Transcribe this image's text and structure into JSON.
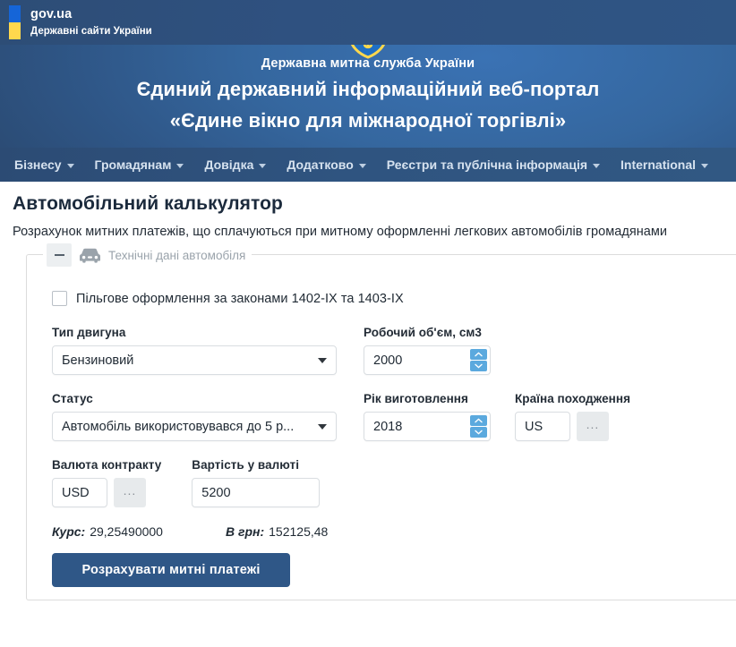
{
  "govbar": {
    "title": "gov.ua",
    "subtitle": "Державні сайти України",
    "flag_blue": "#1565d8",
    "flag_yellow": "#ffd84d"
  },
  "masthead": {
    "emblem": "ukraine-trident-emblem",
    "agency": "Державна митна служба України",
    "portal_line1": "Єдиний державний інформаційний веб-портал",
    "portal_line2": "«Єдине вікно для міжнародної торгівлі»",
    "bg_color": "#35679f"
  },
  "nav": {
    "items": [
      {
        "label": "Бізнесу",
        "has_caret": true
      },
      {
        "label": "Громадянам",
        "has_caret": true
      },
      {
        "label": "Довідка",
        "has_caret": true
      },
      {
        "label": "Додатково",
        "has_caret": true
      },
      {
        "label": "Реєстри та публічна інформація",
        "has_caret": true
      },
      {
        "label": "International",
        "has_caret": true
      }
    ]
  },
  "page": {
    "title": "Автомобільний калькулятор",
    "description": "Розрахунок митних платежів, що сплачуються при митному оформленні легкових автомобілів громадянами"
  },
  "panel": {
    "legend": "Технічні дані автомобіля",
    "collapse_icon": "minus-icon",
    "car_icon": "car-front-icon"
  },
  "form": {
    "privilege_checkbox": {
      "label": "Пільгове оформлення за законами 1402-IX та 1403-IX",
      "checked": false
    },
    "engine_type": {
      "label": "Тип двигуна",
      "value": "Бензиновий"
    },
    "engine_volume": {
      "label": "Робочий об'єм, см3",
      "value": "2000"
    },
    "status": {
      "label": "Статус",
      "value": "Автомобіль використовувався до 5 р..."
    },
    "year": {
      "label": "Рік виготовлення",
      "value": "2018"
    },
    "country": {
      "label": "Країна походження",
      "value": "US",
      "browse_label": "..."
    },
    "currency": {
      "label": "Валюта контракту",
      "value": "USD",
      "browse_label": "..."
    },
    "amount": {
      "label": "Вартість у валюті",
      "value": "5200"
    },
    "rate": {
      "label": "Курс:",
      "value": "29,25490000"
    },
    "uah": {
      "label": "В грн:",
      "value": "152125,48"
    },
    "submit_label": "Розрахувати митні платежі",
    "submit_color": "#2f5787"
  }
}
